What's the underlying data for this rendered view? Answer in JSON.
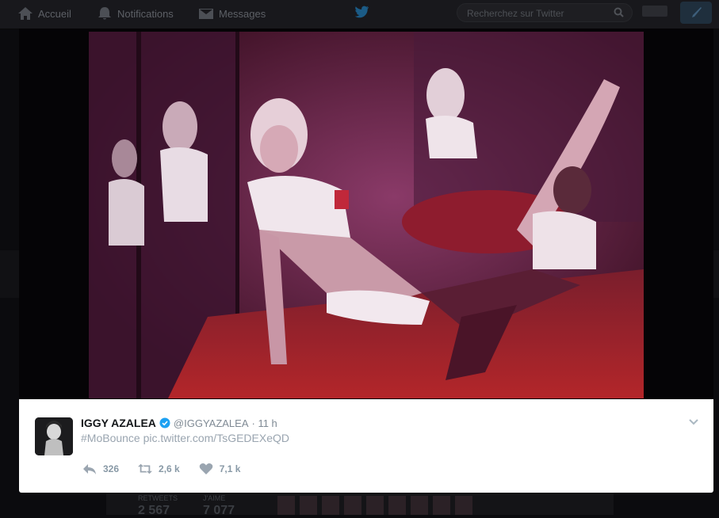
{
  "nav": {
    "home_label": "Accueil",
    "notifications_label": "Notifications",
    "messages_label": "Messages",
    "search_placeholder": "Recherchez sur Twitter"
  },
  "background": {
    "retweets_label": "RETWEETS",
    "likes_label": "J'AIME",
    "retweets_value": "2 567",
    "likes_value": "7 077"
  },
  "tweet": {
    "author_name": "IGGY AZALEA",
    "author_handle": "@IGGYAZALEA",
    "time": "· 11 h",
    "hashtag": "#MoBounce",
    "link": "pic.twitter.com/TsGEDEXeQD",
    "actions": {
      "reply_count": "326",
      "retweet_count": "2,6 k",
      "like_count": "7,1 k"
    }
  },
  "colors": {
    "accent": "#1da1f2",
    "photo_tint": "#6e2034",
    "card_bg": "#ffffff"
  }
}
